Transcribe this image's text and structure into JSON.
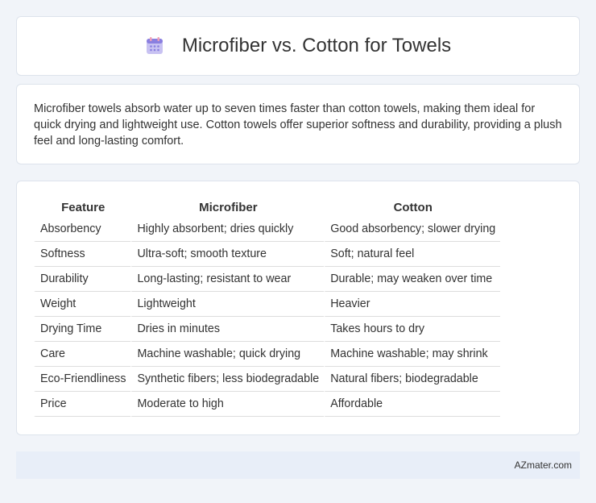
{
  "header": {
    "title": "Microfiber vs. Cotton for Towels",
    "icon": "calendar-icon"
  },
  "summary": {
    "text": "Microfiber towels absorb water up to seven times faster than cotton towels, making them ideal for quick drying and lightweight use. Cotton towels offer superior softness and durability, providing a plush feel and long-lasting comfort."
  },
  "table": {
    "headers": [
      "Feature",
      "Microfiber",
      "Cotton"
    ],
    "rows": [
      [
        "Absorbency",
        "Highly absorbent; dries quickly",
        "Good absorbency; slower drying"
      ],
      [
        "Softness",
        "Ultra-soft; smooth texture",
        "Soft; natural feel"
      ],
      [
        "Durability",
        "Long-lasting; resistant to wear",
        "Durable; may weaken over time"
      ],
      [
        "Weight",
        "Lightweight",
        "Heavier"
      ],
      [
        "Drying Time",
        "Dries in minutes",
        "Takes hours to dry"
      ],
      [
        "Care",
        "Machine washable; quick drying",
        "Machine washable; may shrink"
      ],
      [
        "Eco-Friendliness",
        "Synthetic fibers; less biodegradable",
        "Natural fibers; biodegradable"
      ],
      [
        "Price",
        "Moderate to high",
        "Affordable"
      ]
    ]
  },
  "footer": {
    "text": "AZmater.com"
  },
  "colors": {
    "background": "#f1f4f9",
    "footer_bg": "#e8eef8",
    "icon_purple": "#8a7fe0",
    "icon_pink": "#f0a0b8"
  }
}
